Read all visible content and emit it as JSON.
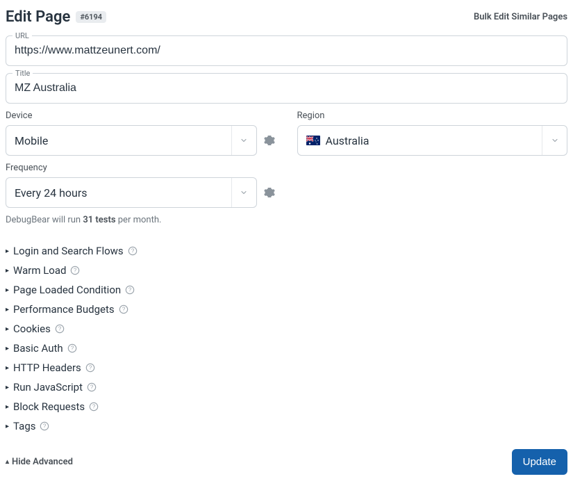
{
  "header": {
    "title": "Edit Page",
    "id_badge": "#6194",
    "bulk_link": "Bulk Edit Similar Pages"
  },
  "fields": {
    "url": {
      "label": "URL",
      "value": "https://www.mattzeunert.com/"
    },
    "title": {
      "label": "Title",
      "value": "MZ Australia"
    },
    "device": {
      "label": "Device",
      "value": "Mobile"
    },
    "region": {
      "label": "Region",
      "value": "Australia",
      "flag_emoji": "🇦🇺"
    },
    "frequency": {
      "label": "Frequency",
      "value": "Every 24 hours"
    }
  },
  "info": {
    "prefix": "DebugBear will run ",
    "count": "31 tests",
    "suffix": " per month."
  },
  "accordion": [
    "Login and Search Flows",
    "Warm Load",
    "Page Loaded Condition",
    "Performance Budgets",
    "Cookies",
    "Basic Auth",
    "HTTP Headers",
    "Run JavaScript",
    "Block Requests",
    "Tags"
  ],
  "footer": {
    "hide_advanced": "Hide Advanced",
    "update": "Update"
  }
}
